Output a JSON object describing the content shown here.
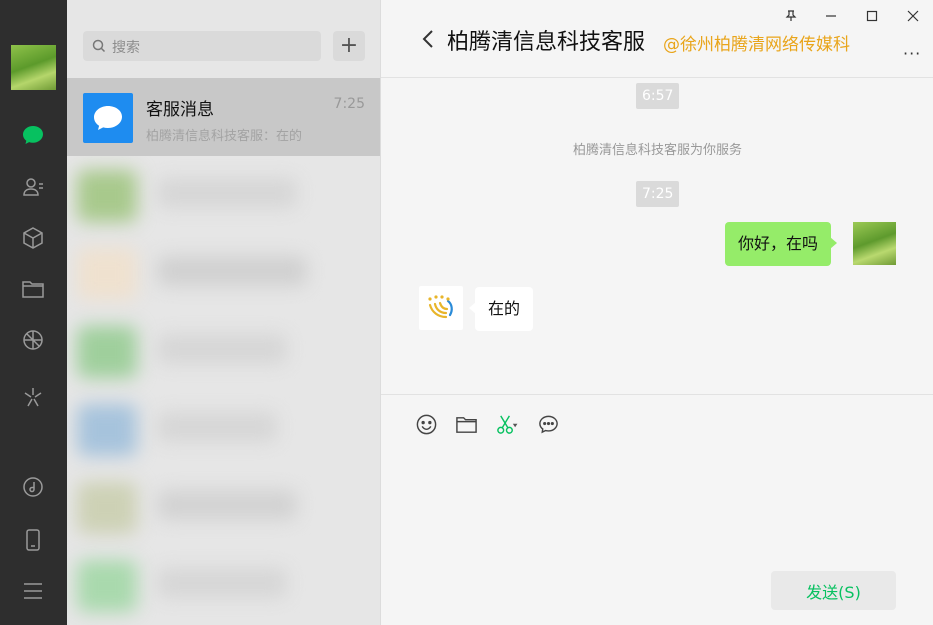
{
  "rail": {
    "icons": [
      "chat-icon",
      "contacts-icon",
      "favorites-icon",
      "files-icon",
      "moments-icon",
      "mini-program-icon",
      "music-icon",
      "phone-icon",
      "menu-icon"
    ],
    "active_color": "#07c160"
  },
  "list": {
    "search_placeholder": "搜索",
    "add_label": "+",
    "active_chat": {
      "name": "客服消息",
      "time": "7:25",
      "preview": "柏腾清信息科技客服：在的"
    }
  },
  "chat": {
    "back_icon": "chevron-left-icon",
    "title": "柏腾清信息科技客服",
    "watermark": "@徐州柏腾清网络传媒科",
    "more_label": "···",
    "window_controls": [
      "pin-icon",
      "minimize-icon",
      "maximize-icon",
      "close-icon"
    ],
    "messages": {
      "time1": "6:57",
      "system": "柏腾清信息科技客服为你服务",
      "time2": "7:25",
      "me": "你好，在吗",
      "them": "在的"
    },
    "toolbar": [
      "emoji-icon",
      "folder-icon",
      "scissors-icon",
      "chat-bubble-icon"
    ],
    "send_label": "发送(S)"
  },
  "colors": {
    "bubble_me": "#95ec69",
    "accent": "#07c160",
    "watermark": "#e9a51b"
  }
}
